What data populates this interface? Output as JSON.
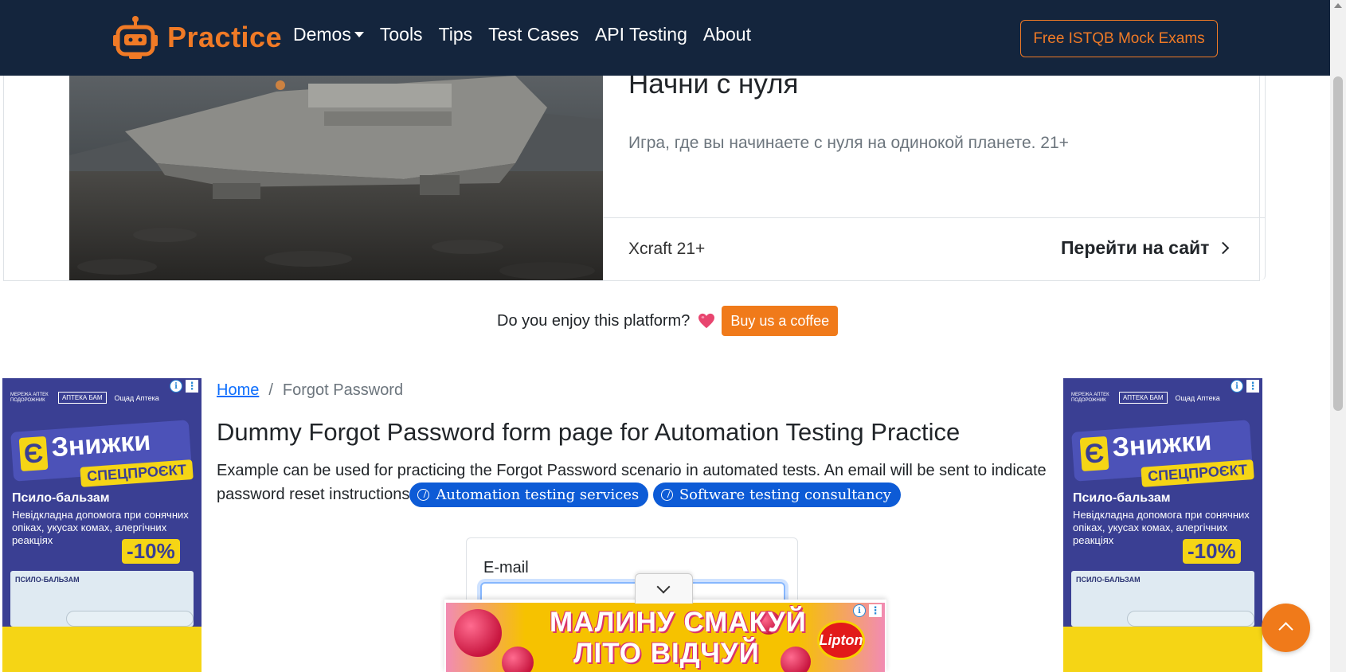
{
  "navbar": {
    "brand": "Practice",
    "links": [
      "Demos",
      "Tools",
      "Tips",
      "Test Cases",
      "API Testing",
      "About"
    ],
    "cta": "Free ISTQB Mock Exams"
  },
  "promo": {
    "title": "Начни с нуля",
    "description": "Игра, где вы начинаете с нуля на одинокой планете. 21+",
    "brand": "Xcraft 21+",
    "link": "Перейти на сайт"
  },
  "coffee": {
    "text": "Do you enjoy this platform?",
    "button": "Buy us a coffee"
  },
  "side_ad": {
    "logo1": "МЕРЕЖА АПТЕК ПОДОРОЖНИК",
    "logo2": "АПТЕКА БАМ",
    "logo3": "Ощад Аптека",
    "badge_letter": "Є",
    "badge_text": "Знижки",
    "badge_sub": "СПЕЦПРОЄКТ",
    "product": "Псило-бальзам",
    "desc": "Невідкладна допомога при сонячних опіках, укусах комах, алергічних реакціях",
    "discount": "-10%",
    "pack_label": "ПСИЛО-БАЛЬЗАМ"
  },
  "breadcrumb": {
    "home": "Home",
    "separator": "/",
    "current": "Forgot Password"
  },
  "main": {
    "title": "Dummy Forgot Password form page for Automation Testing Practice",
    "description": "Example can be used for practicing the Forgot Password scenario in automated tests. An email will be sent to indicate password reset instructions",
    "pill1": "Automation testing services",
    "pill2": "Software testing consultancy"
  },
  "form": {
    "email_label": "E-mail",
    "email_value": ""
  },
  "bottom_ad": {
    "line1": "МАЛИНУ СМАКУЙ",
    "line2": "ЛІТО ВІДЧУЙ",
    "brand": "Lipton"
  },
  "colors": {
    "navbar_bg": "#14253d",
    "accent": "#f07a26",
    "link": "#0d6efd",
    "pill": "#0d5bd6"
  },
  "icons": [
    "robot-logo-icon",
    "caret-down-icon",
    "chevron-right-icon",
    "heart-icon",
    "info-icon",
    "more-vertical-icon",
    "bolt-circle-icon",
    "chevron-down-icon",
    "chevron-up-icon"
  ]
}
